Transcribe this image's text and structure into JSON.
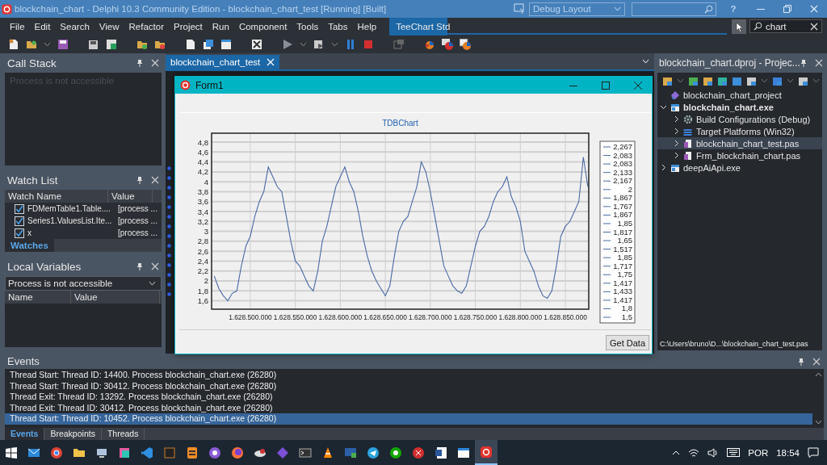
{
  "title_bar": {
    "title": "blockchain_chart - Delphi 10.3 Community Edition - blockchain_chart_test [Running] [Built]",
    "layout_combo": "Debug Layout",
    "help": "?"
  },
  "menu_bar": {
    "items": [
      "File",
      "Edit",
      "Search",
      "View",
      "Refactor",
      "Project",
      "Run",
      "Component",
      "Tools",
      "Tabs",
      "Help"
    ],
    "palette_tabs": [
      {
        "label": "TeeChart Std",
        "selected": true
      }
    ],
    "search": {
      "value": "chart"
    }
  },
  "call_stack": {
    "title": "Call Stack",
    "message": "Process is not accessible"
  },
  "watch_list": {
    "title": "Watch List",
    "columns": [
      "Watch Name",
      "Value"
    ],
    "rows": [
      {
        "name": "FDMemTable1.Table....",
        "value": "[process ...",
        "checked": true
      },
      {
        "name": "Series1.ValuesList.Ite...",
        "value": "[process ...",
        "checked": true
      },
      {
        "name": "x",
        "value": "[process ...",
        "checked": true
      }
    ],
    "tabs": [
      {
        "label": "Watches",
        "selected": true
      }
    ]
  },
  "local_variables": {
    "title": "Local Variables",
    "combo": "Process is not accessible",
    "columns": [
      "Name",
      "Value"
    ]
  },
  "editor": {
    "tabs": [
      {
        "label": "blockchain_chart_test",
        "selected": true
      }
    ]
  },
  "form_window": {
    "title": "Form1",
    "button": "Get Data",
    "chart_data": {
      "type": "line",
      "title": "TDBChart",
      "x": [
        1628460000,
        1628465000,
        1628470000,
        1628475000,
        1628480000,
        1628485000,
        1628490000,
        1628495000,
        1628500000,
        1628505000,
        1628510000,
        1628515000,
        1628520000,
        1628525000,
        1628530000,
        1628535000,
        1628540000,
        1628545000,
        1628550000,
        1628555000,
        1628560000,
        1628565000,
        1628570000,
        1628575000,
        1628580000,
        1628585000,
        1628590000,
        1628595000,
        1628600000,
        1628605000,
        1628610000,
        1628615000,
        1628620000,
        1628625000,
        1628630000,
        1628635000,
        1628640000,
        1628645000,
        1628650000,
        1628655000,
        1628660000,
        1628665000,
        1628670000,
        1628675000,
        1628680000,
        1628685000,
        1628690000,
        1628695000,
        1628700000,
        1628705000,
        1628710000,
        1628715000,
        1628720000,
        1628725000,
        1628730000,
        1628735000,
        1628740000,
        1628745000,
        1628750000,
        1628755000,
        1628760000,
        1628765000,
        1628770000,
        1628775000,
        1628780000,
        1628785000,
        1628790000,
        1628795000,
        1628800000,
        1628805000,
        1628810000,
        1628815000,
        1628820000,
        1628825000,
        1628830000,
        1628835000,
        1628840000,
        1628845000,
        1628850000,
        1628855000,
        1628860000,
        1628865000,
        1628870000,
        1628875000
      ],
      "grid": true,
      "series": [
        {
          "color": "#4a6aa5",
          "values": [
            2.1,
            1.85,
            1.7,
            1.6,
            1.75,
            1.8,
            2.3,
            2.7,
            2.9,
            3.3,
            3.6,
            3.8,
            4.3,
            4.1,
            3.9,
            3.8,
            3.3,
            2.8,
            2.4,
            2.3,
            2.1,
            1.9,
            1.8,
            2.2,
            2.8,
            3.1,
            3.5,
            3.9,
            4.1,
            4.3,
            4.0,
            3.8,
            3.4,
            2.9,
            2.5,
            2.2,
            2.0,
            1.85,
            1.7,
            1.9,
            2.5,
            3.0,
            3.2,
            3.3,
            3.6,
            3.9,
            4.4,
            4.2,
            3.8,
            3.3,
            2.8,
            2.3,
            2.1,
            1.9,
            1.8,
            1.75,
            1.9,
            2.3,
            2.7,
            3.0,
            3.1,
            3.3,
            3.6,
            3.8,
            3.9,
            4.1,
            3.7,
            3.5,
            3.2,
            2.6,
            2.4,
            2.2,
            1.9,
            1.7,
            1.65,
            1.8,
            2.3,
            2.9,
            3.1,
            3.2,
            3.4,
            3.6,
            4.5,
            3.9
          ]
        }
      ],
      "xlim": [
        1628457000,
        1628876000
      ],
      "ylim": [
        1.43,
        4.98
      ],
      "xticks": [
        {
          "value": 1628500000,
          "label": "1.628.500.000"
        },
        {
          "value": 1628550000,
          "label": "1.628.550.000"
        },
        {
          "value": 1628600000,
          "label": "1.628.600.000"
        },
        {
          "value": 1628650000,
          "label": "1.628.650.000"
        },
        {
          "value": 1628700000,
          "label": "1.628.700.000"
        },
        {
          "value": 1628750000,
          "label": "1.628.750.000"
        },
        {
          "value": 1628800000,
          "label": "1.628.800.000"
        },
        {
          "value": 1628850000,
          "label": "1.628.850.000"
        }
      ],
      "yticks": [
        {
          "value": 1.6,
          "label": "1,6"
        },
        {
          "value": 1.8,
          "label": "1,8"
        },
        {
          "value": 2,
          "label": "2"
        },
        {
          "value": 2.2,
          "label": "2,2"
        },
        {
          "value": 2.4,
          "label": "2,4"
        },
        {
          "value": 2.6,
          "label": "2,6"
        },
        {
          "value": 2.8,
          "label": "2,8"
        },
        {
          "value": 3,
          "label": "3"
        },
        {
          "value": 3.2,
          "label": "3,2"
        },
        {
          "value": 3.4,
          "label": "3,4"
        },
        {
          "value": 3.6,
          "label": "3,6"
        },
        {
          "value": 3.8,
          "label": "3,8"
        },
        {
          "value": 4,
          "label": "4"
        },
        {
          "value": 4.2,
          "label": "4,2"
        },
        {
          "value": 4.4,
          "label": "4,4"
        },
        {
          "value": 4.6,
          "label": "4,6"
        },
        {
          "value": 4.8,
          "label": "4,8"
        }
      ]
    },
    "legend": [
      "2,267",
      "2,083",
      "2,083",
      "2,133",
      "2,167",
      "2",
      "1,867",
      "1,767",
      "1,867",
      "1,85",
      "1,817",
      "1,65",
      "1,517",
      "1,85",
      "1,717",
      "1,75",
      "1,417",
      "1,433",
      "1,417",
      "1,8",
      "1,5"
    ]
  },
  "project_manager": {
    "title": "blockchain_chart.dproj - Projec...",
    "tree": [
      {
        "label": "blockchain_chart_project",
        "kind": "group",
        "selected": false,
        "active": false
      },
      {
        "label": "blockchain_chart.exe",
        "kind": "exe",
        "expanded": true,
        "selected": false,
        "active": true,
        "children": [
          {
            "label": "Build Configurations (Debug)",
            "kind": "config",
            "expanded": false,
            "selected": false,
            "active": false
          },
          {
            "label": "Target Platforms (Win32)",
            "kind": "platforms",
            "expanded": false,
            "selected": false,
            "active": false
          },
          {
            "label": "blockchain_chart_test.pas",
            "kind": "unit",
            "expanded": false,
            "selected": true,
            "active": false
          },
          {
            "label": "Frm_blockchain_chart.pas",
            "kind": "unit",
            "expanded": false,
            "selected": false,
            "active": false
          }
        ]
      },
      {
        "label": "deepAiApi.exe",
        "kind": "exe",
        "expanded": false,
        "selected": false,
        "active": false
      }
    ],
    "status": "C:\\Users\\bruno\\D...\\blockchain_chart_test.pas"
  },
  "events": {
    "title": "Events",
    "rows": [
      {
        "text": "Thread Start: Thread ID: 14400. Process blockchain_chart.exe (26280)",
        "selected": false
      },
      {
        "text": "Thread Start: Thread ID: 30412. Process blockchain_chart.exe (26280)",
        "selected": false
      },
      {
        "text": "Thread Exit: Thread ID: 13292. Process blockchain_chart.exe (26280)",
        "selected": false
      },
      {
        "text": "Thread Exit: Thread ID: 30412. Process blockchain_chart.exe (26280)",
        "selected": false
      },
      {
        "text": "Thread Start: Thread ID: 10452. Process blockchain_chart.exe (26280)",
        "selected": true
      }
    ],
    "tabs": [
      {
        "label": "Events",
        "selected": true
      },
      {
        "label": "Breakpoints",
        "selected": false
      },
      {
        "label": "Threads",
        "selected": false
      }
    ]
  },
  "taskbar": {
    "apps": [
      {
        "selected": false
      },
      {
        "selected": false
      },
      {
        "selected": false
      },
      {
        "selected": false
      },
      {
        "selected": false
      },
      {
        "selected": false
      },
      {
        "selected": false
      },
      {
        "selected": false
      },
      {
        "selected": false
      },
      {
        "selected": false
      },
      {
        "selected": false
      },
      {
        "selected": false
      },
      {
        "selected": false
      },
      {
        "selected": false
      },
      {
        "selected": false
      },
      {
        "selected": false
      },
      {
        "selected": false
      },
      {
        "selected": false
      },
      {
        "selected": false
      },
      {
        "selected": false
      },
      {
        "selected": true
      }
    ],
    "language": "POR",
    "time": "18:54"
  }
}
